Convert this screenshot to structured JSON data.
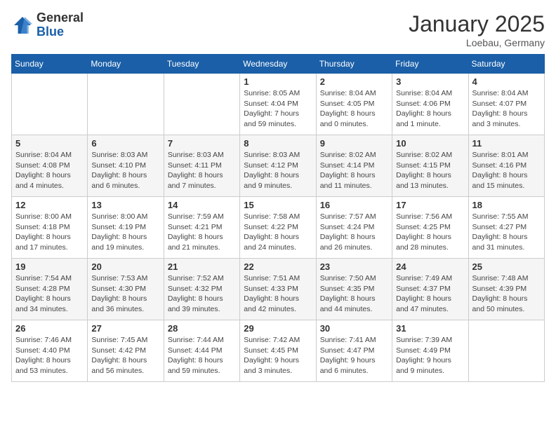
{
  "header": {
    "logo_general": "General",
    "logo_blue": "Blue",
    "month_title": "January 2025",
    "location": "Loebau, Germany"
  },
  "weekdays": [
    "Sunday",
    "Monday",
    "Tuesday",
    "Wednesday",
    "Thursday",
    "Friday",
    "Saturday"
  ],
  "weeks": [
    [
      {
        "day": "",
        "info": ""
      },
      {
        "day": "",
        "info": ""
      },
      {
        "day": "",
        "info": ""
      },
      {
        "day": "1",
        "info": "Sunrise: 8:05 AM\nSunset: 4:04 PM\nDaylight: 7 hours\nand 59 minutes."
      },
      {
        "day": "2",
        "info": "Sunrise: 8:04 AM\nSunset: 4:05 PM\nDaylight: 8 hours\nand 0 minutes."
      },
      {
        "day": "3",
        "info": "Sunrise: 8:04 AM\nSunset: 4:06 PM\nDaylight: 8 hours\nand 1 minute."
      },
      {
        "day": "4",
        "info": "Sunrise: 8:04 AM\nSunset: 4:07 PM\nDaylight: 8 hours\nand 3 minutes."
      }
    ],
    [
      {
        "day": "5",
        "info": "Sunrise: 8:04 AM\nSunset: 4:08 PM\nDaylight: 8 hours\nand 4 minutes."
      },
      {
        "day": "6",
        "info": "Sunrise: 8:03 AM\nSunset: 4:10 PM\nDaylight: 8 hours\nand 6 minutes."
      },
      {
        "day": "7",
        "info": "Sunrise: 8:03 AM\nSunset: 4:11 PM\nDaylight: 8 hours\nand 7 minutes."
      },
      {
        "day": "8",
        "info": "Sunrise: 8:03 AM\nSunset: 4:12 PM\nDaylight: 8 hours\nand 9 minutes."
      },
      {
        "day": "9",
        "info": "Sunrise: 8:02 AM\nSunset: 4:14 PM\nDaylight: 8 hours\nand 11 minutes."
      },
      {
        "day": "10",
        "info": "Sunrise: 8:02 AM\nSunset: 4:15 PM\nDaylight: 8 hours\nand 13 minutes."
      },
      {
        "day": "11",
        "info": "Sunrise: 8:01 AM\nSunset: 4:16 PM\nDaylight: 8 hours\nand 15 minutes."
      }
    ],
    [
      {
        "day": "12",
        "info": "Sunrise: 8:00 AM\nSunset: 4:18 PM\nDaylight: 8 hours\nand 17 minutes."
      },
      {
        "day": "13",
        "info": "Sunrise: 8:00 AM\nSunset: 4:19 PM\nDaylight: 8 hours\nand 19 minutes."
      },
      {
        "day": "14",
        "info": "Sunrise: 7:59 AM\nSunset: 4:21 PM\nDaylight: 8 hours\nand 21 minutes."
      },
      {
        "day": "15",
        "info": "Sunrise: 7:58 AM\nSunset: 4:22 PM\nDaylight: 8 hours\nand 24 minutes."
      },
      {
        "day": "16",
        "info": "Sunrise: 7:57 AM\nSunset: 4:24 PM\nDaylight: 8 hours\nand 26 minutes."
      },
      {
        "day": "17",
        "info": "Sunrise: 7:56 AM\nSunset: 4:25 PM\nDaylight: 8 hours\nand 28 minutes."
      },
      {
        "day": "18",
        "info": "Sunrise: 7:55 AM\nSunset: 4:27 PM\nDaylight: 8 hours\nand 31 minutes."
      }
    ],
    [
      {
        "day": "19",
        "info": "Sunrise: 7:54 AM\nSunset: 4:28 PM\nDaylight: 8 hours\nand 34 minutes."
      },
      {
        "day": "20",
        "info": "Sunrise: 7:53 AM\nSunset: 4:30 PM\nDaylight: 8 hours\nand 36 minutes."
      },
      {
        "day": "21",
        "info": "Sunrise: 7:52 AM\nSunset: 4:32 PM\nDaylight: 8 hours\nand 39 minutes."
      },
      {
        "day": "22",
        "info": "Sunrise: 7:51 AM\nSunset: 4:33 PM\nDaylight: 8 hours\nand 42 minutes."
      },
      {
        "day": "23",
        "info": "Sunrise: 7:50 AM\nSunset: 4:35 PM\nDaylight: 8 hours\nand 44 minutes."
      },
      {
        "day": "24",
        "info": "Sunrise: 7:49 AM\nSunset: 4:37 PM\nDaylight: 8 hours\nand 47 minutes."
      },
      {
        "day": "25",
        "info": "Sunrise: 7:48 AM\nSunset: 4:39 PM\nDaylight: 8 hours\nand 50 minutes."
      }
    ],
    [
      {
        "day": "26",
        "info": "Sunrise: 7:46 AM\nSunset: 4:40 PM\nDaylight: 8 hours\nand 53 minutes."
      },
      {
        "day": "27",
        "info": "Sunrise: 7:45 AM\nSunset: 4:42 PM\nDaylight: 8 hours\nand 56 minutes."
      },
      {
        "day": "28",
        "info": "Sunrise: 7:44 AM\nSunset: 4:44 PM\nDaylight: 8 hours\nand 59 minutes."
      },
      {
        "day": "29",
        "info": "Sunrise: 7:42 AM\nSunset: 4:45 PM\nDaylight: 9 hours\nand 3 minutes."
      },
      {
        "day": "30",
        "info": "Sunrise: 7:41 AM\nSunset: 4:47 PM\nDaylight: 9 hours\nand 6 minutes."
      },
      {
        "day": "31",
        "info": "Sunrise: 7:39 AM\nSunset: 4:49 PM\nDaylight: 9 hours\nand 9 minutes."
      },
      {
        "day": "",
        "info": ""
      }
    ]
  ]
}
